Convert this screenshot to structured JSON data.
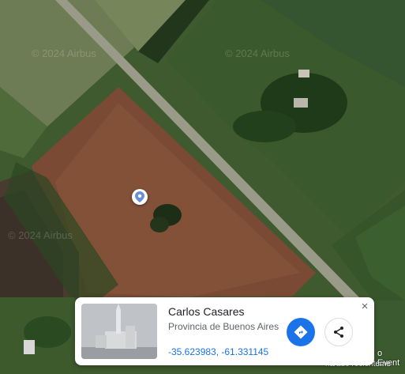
{
  "map": {
    "watermark_text": "© 2024 Airbus",
    "attribution_line1": "o Event",
    "attribution_line2": "ha/ado recienteme"
  },
  "card": {
    "title": "Carlos Casares",
    "subtitle": "Provincia de Buenos Aires",
    "coordinates": "-35.623983, -61.331145",
    "close_label": "×",
    "directions_icon": "directions-icon",
    "share_icon": "share-icon",
    "accent_color": "#1a73e8"
  }
}
